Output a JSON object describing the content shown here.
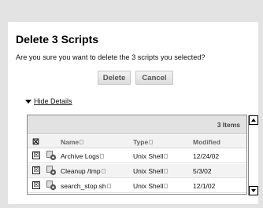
{
  "dialog": {
    "title": "Delete 3 Scripts",
    "question": "Are you sure you want to delete the 3 scripts you selected?",
    "delete_label": "Delete",
    "cancel_label": "Cancel",
    "details_label": "Hide Details"
  },
  "table": {
    "count_label": "3 Items",
    "columns": {
      "name": "Name",
      "type": "Type",
      "modified": "Modified"
    },
    "header_check": "☒",
    "rows": [
      {
        "check": "☒",
        "name": "Archive Logs",
        "type": "Unix Shell",
        "modified": "12/24/02"
      },
      {
        "check": "☒",
        "name": "Cleanup /tmp",
        "type": "Unix Shell",
        "modified": "5/3/02"
      },
      {
        "check": "☒",
        "name": "search_stop.sh",
        "type": "Unix Shell",
        "modified": "12/1/02"
      }
    ]
  },
  "icons": {
    "row_icon": "gear-script-icon",
    "sort": "sort-indicator-icon"
  }
}
